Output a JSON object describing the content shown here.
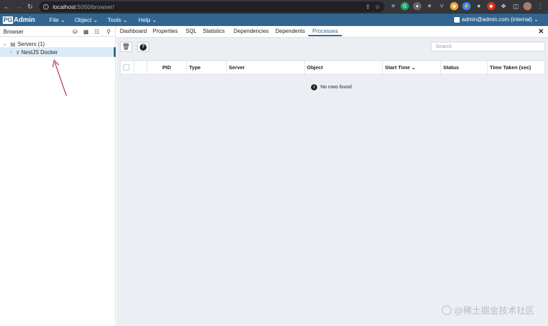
{
  "browser": {
    "url_host": "localhost",
    "url_path": ":5050/browser/"
  },
  "menubar": {
    "logo_pg": "PG",
    "logo_admin": "Admin",
    "menus": [
      "File ⌄",
      "Object ⌄",
      "Tools ⌄",
      "Help ⌄"
    ],
    "user": "admin@admin.com (internal) ⌄"
  },
  "browser_panel": {
    "title": "Browser",
    "tree": {
      "servers_label": "Servers (1)",
      "server_label": "NestJS Docker"
    }
  },
  "tabs": [
    "Dashboard",
    "Properties",
    "SQL",
    "Statistics",
    "Dependencies",
    "Dependents",
    "Processes"
  ],
  "active_tab": "Processes",
  "processes": {
    "search_placeholder": "Search",
    "columns": [
      "PID",
      "Type",
      "Server",
      "Object",
      "Start Time ⌄",
      "Status",
      "Time Taken (sec)"
    ],
    "empty_message": "No rows found"
  },
  "watermark": "@稀土掘金技术社区",
  "colors": {
    "brand": "#326690",
    "annotation_arrow": "#b0406a"
  }
}
